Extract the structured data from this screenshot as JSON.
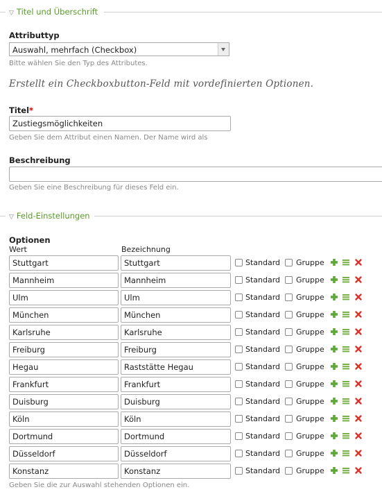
{
  "section1": {
    "legend": "Titel und Überschrift"
  },
  "attribute_type": {
    "label": "Attributtyp",
    "selected": "Auswahl, mehrfach (Checkbox)",
    "help": "Bitte wählen Sie den Typ des Attributes.",
    "description": "Erstellt ein Checkboxbutton-Feld mit vordefinierten Optionen."
  },
  "title_field": {
    "label": "Titel",
    "required_mark": "*",
    "value": "Zustiegsmöglichkeiten",
    "help": "Geben Sie dem Attribut einen Namen. Der Name wird als"
  },
  "description_field": {
    "label": "Beschreibung",
    "value": "",
    "help": "Geben Sie eine Beschreibung für dieses Feld ein."
  },
  "section2": {
    "legend": "Feld-Einstellungen"
  },
  "options": {
    "label": "Optionen",
    "col_value": "Wert",
    "col_label": "Bezeichnung",
    "standard_label": "Standard",
    "group_label": "Gruppe",
    "help": "Geben Sie die zur Auswahl stehenden Optionen ein.",
    "rows": [
      {
        "value": "Stuttgart",
        "label": "Stuttgart"
      },
      {
        "value": "Mannheim",
        "label": "Mannheim"
      },
      {
        "value": "Ulm",
        "label": "Ulm"
      },
      {
        "value": "München",
        "label": "München"
      },
      {
        "value": "Karlsruhe",
        "label": "Karlsruhe"
      },
      {
        "value": "Freiburg",
        "label": "Freiburg"
      },
      {
        "value": "Hegau",
        "label": "Raststätte Hegau"
      },
      {
        "value": "Frankfurt",
        "label": "Frankfurt"
      },
      {
        "value": "Duisburg",
        "label": "Duisburg"
      },
      {
        "value": "Köln",
        "label": "Köln"
      },
      {
        "value": "Dortmund",
        "label": "Dortmund"
      },
      {
        "value": "Düsseldorf",
        "label": "Düsseldorf"
      },
      {
        "value": "Konstanz",
        "label": "Konstanz"
      }
    ]
  },
  "colors": {
    "accent": "#5a9a2a",
    "delete": "#d9332b",
    "required": "#cc0000"
  },
  "icons": {
    "add": "plus-icon",
    "reorder": "drag-handle-icon",
    "remove": "delete-icon"
  }
}
